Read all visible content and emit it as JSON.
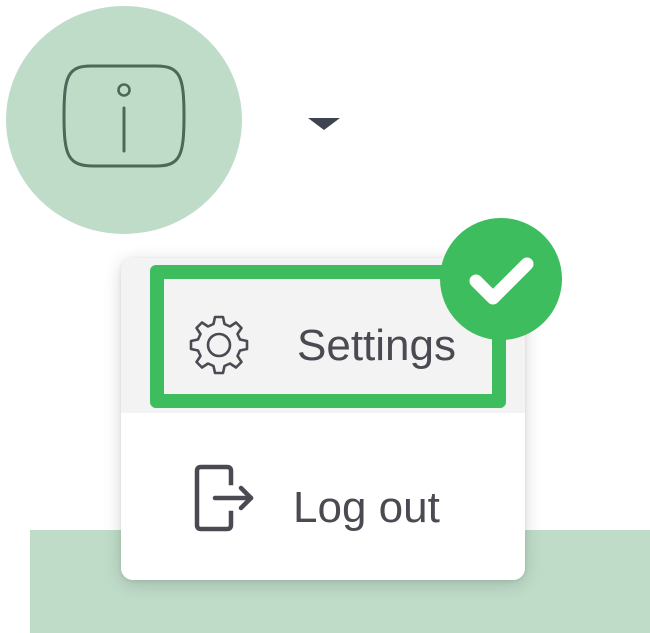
{
  "user": {
    "avatar_icon": "info-icon",
    "menu_toggle_icon": "caret-down-icon"
  },
  "menu": {
    "items": [
      {
        "label": "Settings",
        "icon": "gear-icon",
        "highlighted": true
      },
      {
        "label": "Log out",
        "icon": "logout-icon"
      }
    ]
  },
  "annotation": {
    "icon": "checkmark-icon",
    "color": "#3dbd5d"
  },
  "colors": {
    "avatar_bg": "#bfdcc9",
    "menu_text": "#4a4a52",
    "highlight": "#3dbd5d"
  }
}
